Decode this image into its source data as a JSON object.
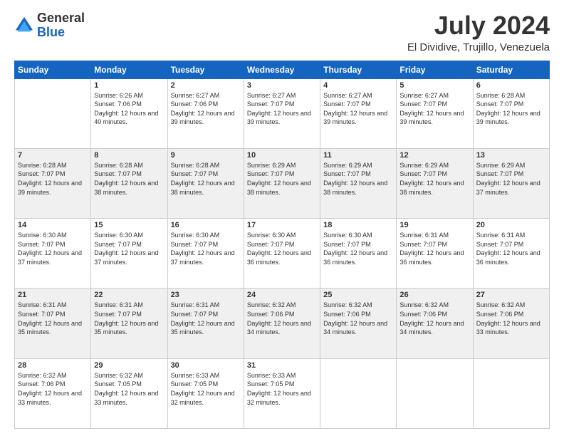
{
  "header": {
    "logo": {
      "general": "General",
      "blue": "Blue"
    },
    "title": "July 2024",
    "location": "El Dividive, Trujillo, Venezuela"
  },
  "weekdays": [
    "Sunday",
    "Monday",
    "Tuesday",
    "Wednesday",
    "Thursday",
    "Friday",
    "Saturday"
  ],
  "weeks": [
    [
      {
        "day": "",
        "sunrise": "",
        "sunset": "",
        "daylight": ""
      },
      {
        "day": "1",
        "sunrise": "Sunrise: 6:26 AM",
        "sunset": "Sunset: 7:06 PM",
        "daylight": "Daylight: 12 hours and 40 minutes."
      },
      {
        "day": "2",
        "sunrise": "Sunrise: 6:27 AM",
        "sunset": "Sunset: 7:06 PM",
        "daylight": "Daylight: 12 hours and 39 minutes."
      },
      {
        "day": "3",
        "sunrise": "Sunrise: 6:27 AM",
        "sunset": "Sunset: 7:07 PM",
        "daylight": "Daylight: 12 hours and 39 minutes."
      },
      {
        "day": "4",
        "sunrise": "Sunrise: 6:27 AM",
        "sunset": "Sunset: 7:07 PM",
        "daylight": "Daylight: 12 hours and 39 minutes."
      },
      {
        "day": "5",
        "sunrise": "Sunrise: 6:27 AM",
        "sunset": "Sunset: 7:07 PM",
        "daylight": "Daylight: 12 hours and 39 minutes."
      },
      {
        "day": "6",
        "sunrise": "Sunrise: 6:28 AM",
        "sunset": "Sunset: 7:07 PM",
        "daylight": "Daylight: 12 hours and 39 minutes."
      }
    ],
    [
      {
        "day": "7",
        "sunrise": "Sunrise: 6:28 AM",
        "sunset": "Sunset: 7:07 PM",
        "daylight": "Daylight: 12 hours and 39 minutes."
      },
      {
        "day": "8",
        "sunrise": "Sunrise: 6:28 AM",
        "sunset": "Sunset: 7:07 PM",
        "daylight": "Daylight: 12 hours and 38 minutes."
      },
      {
        "day": "9",
        "sunrise": "Sunrise: 6:28 AM",
        "sunset": "Sunset: 7:07 PM",
        "daylight": "Daylight: 12 hours and 38 minutes."
      },
      {
        "day": "10",
        "sunrise": "Sunrise: 6:29 AM",
        "sunset": "Sunset: 7:07 PM",
        "daylight": "Daylight: 12 hours and 38 minutes."
      },
      {
        "day": "11",
        "sunrise": "Sunrise: 6:29 AM",
        "sunset": "Sunset: 7:07 PM",
        "daylight": "Daylight: 12 hours and 38 minutes."
      },
      {
        "day": "12",
        "sunrise": "Sunrise: 6:29 AM",
        "sunset": "Sunset: 7:07 PM",
        "daylight": "Daylight: 12 hours and 38 minutes."
      },
      {
        "day": "13",
        "sunrise": "Sunrise: 6:29 AM",
        "sunset": "Sunset: 7:07 PM",
        "daylight": "Daylight: 12 hours and 37 minutes."
      }
    ],
    [
      {
        "day": "14",
        "sunrise": "Sunrise: 6:30 AM",
        "sunset": "Sunset: 7:07 PM",
        "daylight": "Daylight: 12 hours and 37 minutes."
      },
      {
        "day": "15",
        "sunrise": "Sunrise: 6:30 AM",
        "sunset": "Sunset: 7:07 PM",
        "daylight": "Daylight: 12 hours and 37 minutes."
      },
      {
        "day": "16",
        "sunrise": "Sunrise: 6:30 AM",
        "sunset": "Sunset: 7:07 PM",
        "daylight": "Daylight: 12 hours and 37 minutes."
      },
      {
        "day": "17",
        "sunrise": "Sunrise: 6:30 AM",
        "sunset": "Sunset: 7:07 PM",
        "daylight": "Daylight: 12 hours and 36 minutes."
      },
      {
        "day": "18",
        "sunrise": "Sunrise: 6:30 AM",
        "sunset": "Sunset: 7:07 PM",
        "daylight": "Daylight: 12 hours and 36 minutes."
      },
      {
        "day": "19",
        "sunrise": "Sunrise: 6:31 AM",
        "sunset": "Sunset: 7:07 PM",
        "daylight": "Daylight: 12 hours and 36 minutes."
      },
      {
        "day": "20",
        "sunrise": "Sunrise: 6:31 AM",
        "sunset": "Sunset: 7:07 PM",
        "daylight": "Daylight: 12 hours and 36 minutes."
      }
    ],
    [
      {
        "day": "21",
        "sunrise": "Sunrise: 6:31 AM",
        "sunset": "Sunset: 7:07 PM",
        "daylight": "Daylight: 12 hours and 35 minutes."
      },
      {
        "day": "22",
        "sunrise": "Sunrise: 6:31 AM",
        "sunset": "Sunset: 7:07 PM",
        "daylight": "Daylight: 12 hours and 35 minutes."
      },
      {
        "day": "23",
        "sunrise": "Sunrise: 6:31 AM",
        "sunset": "Sunset: 7:07 PM",
        "daylight": "Daylight: 12 hours and 35 minutes."
      },
      {
        "day": "24",
        "sunrise": "Sunrise: 6:32 AM",
        "sunset": "Sunset: 7:06 PM",
        "daylight": "Daylight: 12 hours and 34 minutes."
      },
      {
        "day": "25",
        "sunrise": "Sunrise: 6:32 AM",
        "sunset": "Sunset: 7:06 PM",
        "daylight": "Daylight: 12 hours and 34 minutes."
      },
      {
        "day": "26",
        "sunrise": "Sunrise: 6:32 AM",
        "sunset": "Sunset: 7:06 PM",
        "daylight": "Daylight: 12 hours and 34 minutes."
      },
      {
        "day": "27",
        "sunrise": "Sunrise: 6:32 AM",
        "sunset": "Sunset: 7:06 PM",
        "daylight": "Daylight: 12 hours and 33 minutes."
      }
    ],
    [
      {
        "day": "28",
        "sunrise": "Sunrise: 6:32 AM",
        "sunset": "Sunset: 7:06 PM",
        "daylight": "Daylight: 12 hours and 33 minutes."
      },
      {
        "day": "29",
        "sunrise": "Sunrise: 6:32 AM",
        "sunset": "Sunset: 7:05 PM",
        "daylight": "Daylight: 12 hours and 33 minutes."
      },
      {
        "day": "30",
        "sunrise": "Sunrise: 6:33 AM",
        "sunset": "Sunset: 7:05 PM",
        "daylight": "Daylight: 12 hours and 32 minutes."
      },
      {
        "day": "31",
        "sunrise": "Sunrise: 6:33 AM",
        "sunset": "Sunset: 7:05 PM",
        "daylight": "Daylight: 12 hours and 32 minutes."
      },
      {
        "day": "",
        "sunrise": "",
        "sunset": "",
        "daylight": ""
      },
      {
        "day": "",
        "sunrise": "",
        "sunset": "",
        "daylight": ""
      },
      {
        "day": "",
        "sunrise": "",
        "sunset": "",
        "daylight": ""
      }
    ]
  ]
}
